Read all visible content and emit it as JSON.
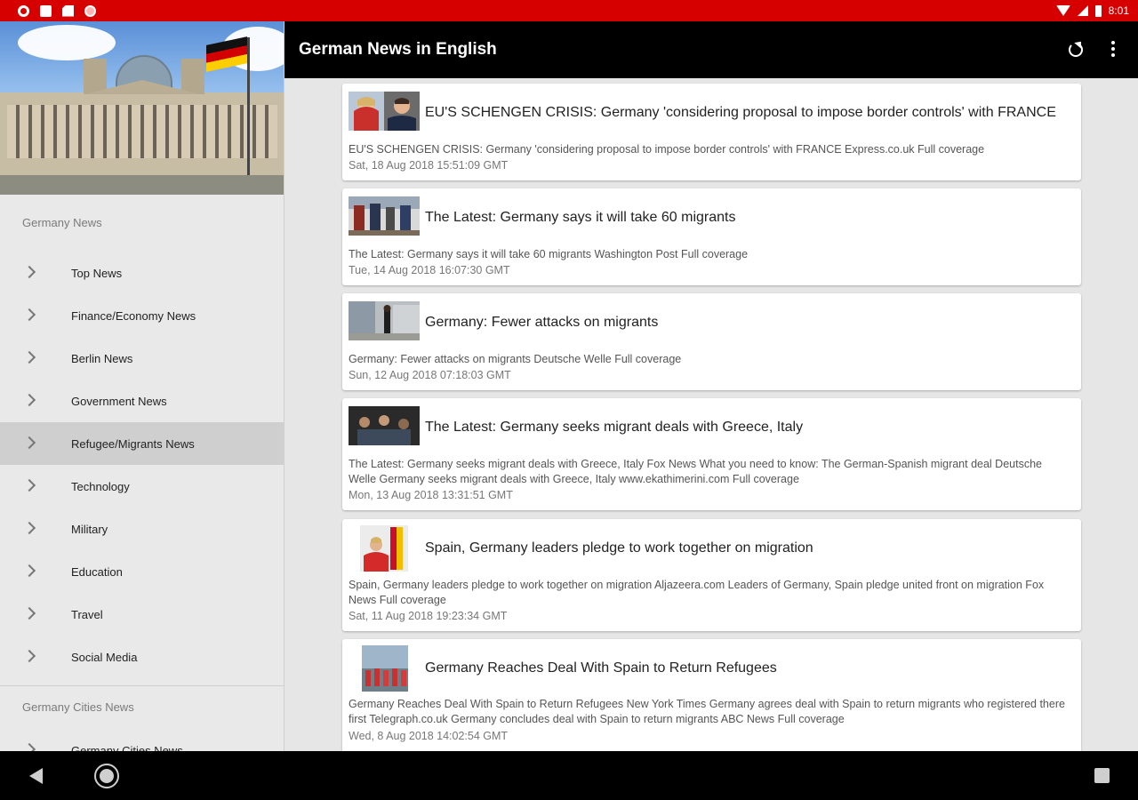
{
  "status_bar": {
    "time": "8:01"
  },
  "toolbar": {
    "title": "German News in English"
  },
  "drawer": {
    "section1_title": "Germany News",
    "items": [
      {
        "label": "Top News"
      },
      {
        "label": "Finance/Economy News"
      },
      {
        "label": "Berlin News"
      },
      {
        "label": "Government News"
      },
      {
        "label": "Refugee/Migrants News"
      },
      {
        "label": "Technology"
      },
      {
        "label": "Military"
      },
      {
        "label": "Education"
      },
      {
        "label": "Travel"
      },
      {
        "label": "Social Media"
      }
    ],
    "section2_title": "Germany Cities News",
    "section2_items": [
      {
        "label": "Germany Cities News"
      }
    ]
  },
  "articles": [
    {
      "title": "EU'S SCHENGEN CRISIS: Germany 'considering proposal to impose border controls' with FRANCE",
      "desc": "EU'S SCHENGEN CRISIS: Germany 'considering proposal to impose border controls' with FRANCE  Express.co.uk  Full coverage",
      "date": "Sat, 18 Aug 2018 15:51:09 GMT"
    },
    {
      "title": "The Latest: Germany says it will take 60 migrants",
      "desc": "The Latest: Germany says it will take 60 migrants  Washington Post  Full coverage",
      "date": "Tue, 14 Aug 2018 16:07:30 GMT"
    },
    {
      "title": "Germany: Fewer attacks on migrants",
      "desc": "Germany: Fewer attacks on migrants  Deutsche Welle  Full coverage",
      "date": "Sun, 12 Aug 2018 07:18:03 GMT"
    },
    {
      "title": "The Latest: Germany seeks migrant deals with Greece, Italy",
      "desc": "The Latest: Germany seeks migrant deals with Greece, Italy  Fox News  What you need to know: The German-Spanish migrant deal  Deutsche Welle  Germany seeks migrant deals with Greece, Italy  www.ekathimerini.com  Full coverage",
      "date": "Mon, 13 Aug 2018 13:31:51 GMT"
    },
    {
      "title": "Spain, Germany leaders pledge to work together on migration",
      "desc": "Spain, Germany leaders pledge to work together on migration  Aljazeera.com  Leaders of Germany, Spain pledge united front on migration  Fox News  Full coverage",
      "date": "Sat, 11 Aug 2018 19:23:34 GMT"
    },
    {
      "title": "Germany Reaches Deal With Spain to Return Refugees",
      "desc": "Germany Reaches Deal With Spain to Return Refugees  New York Times  Germany agrees deal with Spain to return migrants who registered there first  Telegraph.co.uk  Germany concludes deal with Spain to return migrants  ABC News  Full coverage",
      "date": "Wed, 8 Aug 2018 14:02:54 GMT"
    }
  ]
}
